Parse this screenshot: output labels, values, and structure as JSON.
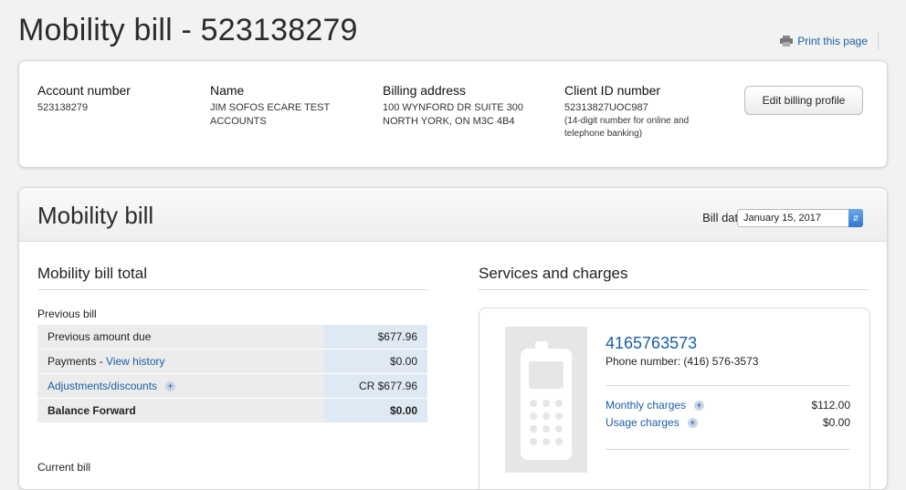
{
  "header": {
    "title": "Mobility bill - 523138279",
    "print_label": "Print this page"
  },
  "account": {
    "account_number_label": "Account number",
    "account_number_value": "523138279",
    "name_label": "Name",
    "name_value": "JIM SOFOS ECARE TEST\nACCOUNTS",
    "address_label": "Billing address",
    "address_value": "100 WYNFORD DR SUITE 300\nNORTH YORK, ON M3C 4B4",
    "client_id_label": "Client ID number",
    "client_id_value": "52313827UOC987",
    "client_id_note": "(14-digit number for online and\ntelephone banking)",
    "edit_button": "Edit billing profile"
  },
  "bill": {
    "title": "Mobility bill",
    "date_label": "Bill date:",
    "date_value": "January 15, 2017",
    "total_title": "Mobility bill total",
    "previous_label": "Previous bill",
    "rows": [
      {
        "desc": "Previous amount due",
        "amount": "$677.96"
      },
      {
        "desc": "Payments - ",
        "link": "View history",
        "amount": "$0.00"
      },
      {
        "desc": "Adjustments/discounts",
        "amount": "CR $677.96"
      },
      {
        "desc": "Balance Forward",
        "amount": "$0.00"
      }
    ],
    "current_label": "Current bill"
  },
  "services": {
    "title": "Services and charges",
    "phone_number": "4165763573",
    "phone_sub": "Phone number: (416) 576-3573",
    "charges": [
      {
        "label": "Monthly charges",
        "amount": "$112.00"
      },
      {
        "label": "Usage charges",
        "amount": "$0.00"
      }
    ]
  },
  "colors": {
    "link": "#1a5fa6",
    "accent_select": "#2f78d1"
  },
  "icons": [
    "printer-icon",
    "select-arrows-icon",
    "expand-plus-icon",
    "mobile-phone-icon"
  ]
}
